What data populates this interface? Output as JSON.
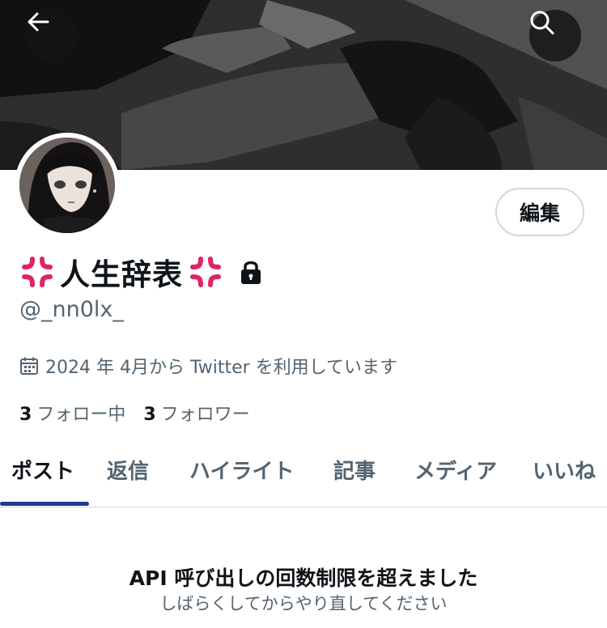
{
  "header": {
    "back_icon": "arrow-left-icon",
    "search_icon": "search-icon"
  },
  "profile": {
    "display_name": "人生辞表",
    "name_emoji": "anger-symbol-icon",
    "lock_icon": "lock-icon",
    "handle": "@_nn0lx_",
    "joined": "2024 年 4月から Twitter を利用しています",
    "following_count": "3",
    "following_label": "フォロー中",
    "followers_count": "3",
    "followers_label": "フォロワー",
    "edit_label": "編集"
  },
  "tabs": [
    {
      "label": "ポスト",
      "active": true
    },
    {
      "label": "返信"
    },
    {
      "label": "ハイライト"
    },
    {
      "label": "記事"
    },
    {
      "label": "メディア"
    },
    {
      "label": "いいね"
    }
  ],
  "message": {
    "title": "API 呼び出しの回数制限を超えました",
    "subtitle": "しばらくしてからやり直してください"
  },
  "colors": {
    "tab_indicator": "#1d3c8f",
    "secondary_text": "#536471",
    "anger_red": "#e0245e"
  }
}
